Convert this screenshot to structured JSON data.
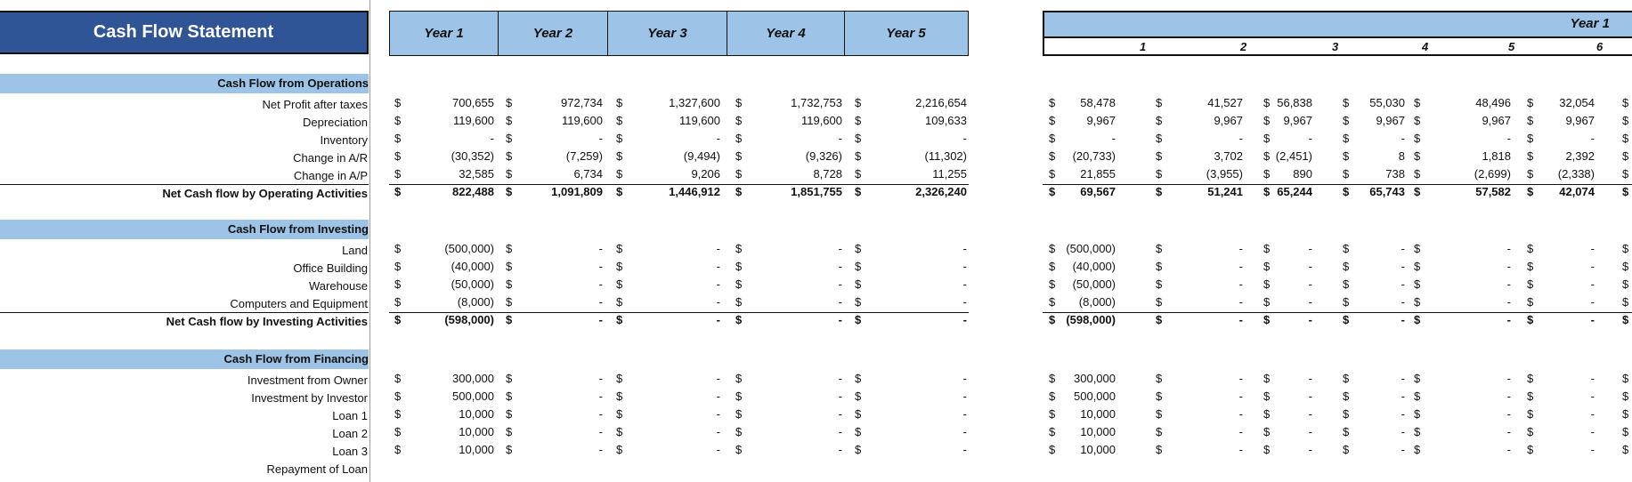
{
  "title": "Cash Flow Statement",
  "year_headers": [
    "Year 1",
    "Year 2",
    "Year 3",
    "Year 4",
    "Year 5"
  ],
  "monthly_header": {
    "year_label": "Year 1",
    "months": [
      "1",
      "2",
      "3",
      "4",
      "5",
      "6"
    ]
  },
  "currency_symbol": "$",
  "sections": [
    {
      "header": "Cash Flow from Operations",
      "rows": [
        {
          "label": "Net Profit after taxes",
          "years": [
            "700,655",
            "972,734",
            "1,327,600",
            "1,732,753",
            "2,216,654"
          ],
          "months": [
            "58,478",
            "41,527",
            "56,838",
            "55,030",
            "48,496",
            "32,054"
          ]
        },
        {
          "label": "Depreciation",
          "years": [
            "119,600",
            "119,600",
            "119,600",
            "119,600",
            "109,633"
          ],
          "months": [
            "9,967",
            "9,967",
            "9,967",
            "9,967",
            "9,967",
            "9,967"
          ]
        },
        {
          "label": "Inventory",
          "years": [
            "-",
            "-",
            "-",
            "-",
            "-"
          ],
          "months": [
            "-",
            "-",
            "-",
            "-",
            "-",
            "-"
          ]
        },
        {
          "label": "Change in A/R",
          "years": [
            "(30,352)",
            "(7,259)",
            "(9,494)",
            "(9,326)",
            "(11,302)"
          ],
          "months": [
            "(20,733)",
            "3,702",
            "(2,451)",
            "8",
            "1,818",
            "2,392"
          ]
        },
        {
          "label": "Change in A/P",
          "years": [
            "32,585",
            "6,734",
            "9,206",
            "8,728",
            "11,255"
          ],
          "months": [
            "21,855",
            "(3,955)",
            "890",
            "738",
            "(2,699)",
            "(2,338)"
          ]
        }
      ],
      "total": {
        "label": "Net Cash flow by Operating Activities",
        "years": [
          "822,488",
          "1,091,809",
          "1,446,912",
          "1,851,755",
          "2,326,240"
        ],
        "months": [
          "69,567",
          "51,241",
          "65,244",
          "65,743",
          "57,582",
          "42,074"
        ]
      }
    },
    {
      "header": "Cash Flow from Investing",
      "rows": [
        {
          "label": "Land",
          "years": [
            "(500,000)",
            "-",
            "-",
            "-",
            "-"
          ],
          "months": [
            "(500,000)",
            "-",
            "-",
            "-",
            "-",
            "-"
          ]
        },
        {
          "label": "Office Building",
          "years": [
            "(40,000)",
            "-",
            "-",
            "-",
            "-"
          ],
          "months": [
            "(40,000)",
            "-",
            "-",
            "-",
            "-",
            "-"
          ]
        },
        {
          "label": "Warehouse",
          "years": [
            "(50,000)",
            "-",
            "-",
            "-",
            "-"
          ],
          "months": [
            "(50,000)",
            "-",
            "-",
            "-",
            "-",
            "-"
          ]
        },
        {
          "label": "Computers and Equipment",
          "years": [
            "(8,000)",
            "-",
            "-",
            "-",
            "-"
          ],
          "months": [
            "(8,000)",
            "-",
            "-",
            "-",
            "-",
            "-"
          ]
        }
      ],
      "total": {
        "label": "Net Cash flow by Investing Activities",
        "years": [
          "(598,000)",
          "-",
          "-",
          "-",
          "-"
        ],
        "months": [
          "(598,000)",
          "-",
          "-",
          "-",
          "-",
          "-"
        ]
      }
    },
    {
      "header": "Cash Flow from Financing",
      "rows": [
        {
          "label": "Investment from Owner",
          "years": [
            "300,000",
            "-",
            "-",
            "-",
            "-"
          ],
          "months": [
            "300,000",
            "-",
            "-",
            "-",
            "-",
            "-"
          ]
        },
        {
          "label": "Investment by Investor",
          "years": [
            "500,000",
            "-",
            "-",
            "-",
            "-"
          ],
          "months": [
            "500,000",
            "-",
            "-",
            "-",
            "-",
            "-"
          ]
        },
        {
          "label": "Loan 1",
          "years": [
            "10,000",
            "-",
            "-",
            "-",
            "-"
          ],
          "months": [
            "10,000",
            "-",
            "-",
            "-",
            "-",
            "-"
          ]
        },
        {
          "label": "Loan 2",
          "years": [
            "10,000",
            "-",
            "-",
            "-",
            "-"
          ],
          "months": [
            "10,000",
            "-",
            "-",
            "-",
            "-",
            "-"
          ]
        },
        {
          "label": "Loan 3",
          "years": [
            "10,000",
            "-",
            "-",
            "-",
            "-"
          ],
          "months": [
            "10,000",
            "-",
            "-",
            "-",
            "-",
            "-"
          ]
        },
        {
          "label": "Repayment of Loan",
          "years": [],
          "months": []
        }
      ]
    }
  ]
}
